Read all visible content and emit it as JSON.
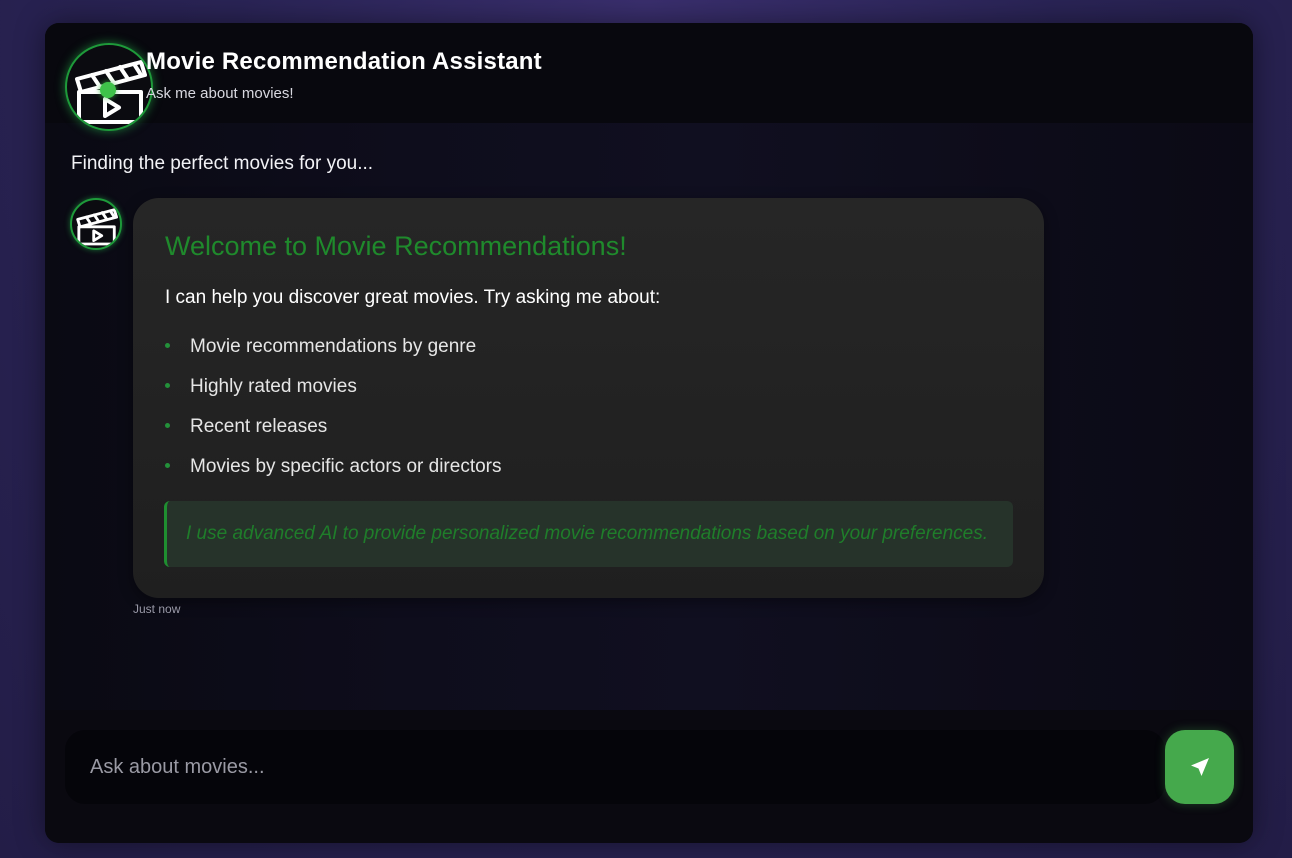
{
  "header": {
    "title": "Movie Recommendation Assistant",
    "subtitle": "Ask me about movies!",
    "avatar_icon": "clapperboard-icon",
    "status_indicator": "online-dot"
  },
  "chat": {
    "status_text": "Finding the perfect movies for you...",
    "messages": [
      {
        "sender_avatar_icon": "clapperboard-icon",
        "title": "Welcome to Movie Recommendations!",
        "intro": "I can help you discover great movies. Try asking me about:",
        "topics": [
          "Movie recommendations by genre",
          "Highly rated movies",
          "Recent releases",
          "Movies by specific actors or directors"
        ],
        "note": "I use advanced AI to provide personalized movie recommendations based on your preferences.",
        "timestamp": "Just now"
      }
    ]
  },
  "composer": {
    "placeholder": "Ask about movies...",
    "value": "",
    "send_icon": "send-icon"
  },
  "colors": {
    "accent": "#45a94c",
    "title_green": "#1f8a2c",
    "background": "#2a2456"
  }
}
